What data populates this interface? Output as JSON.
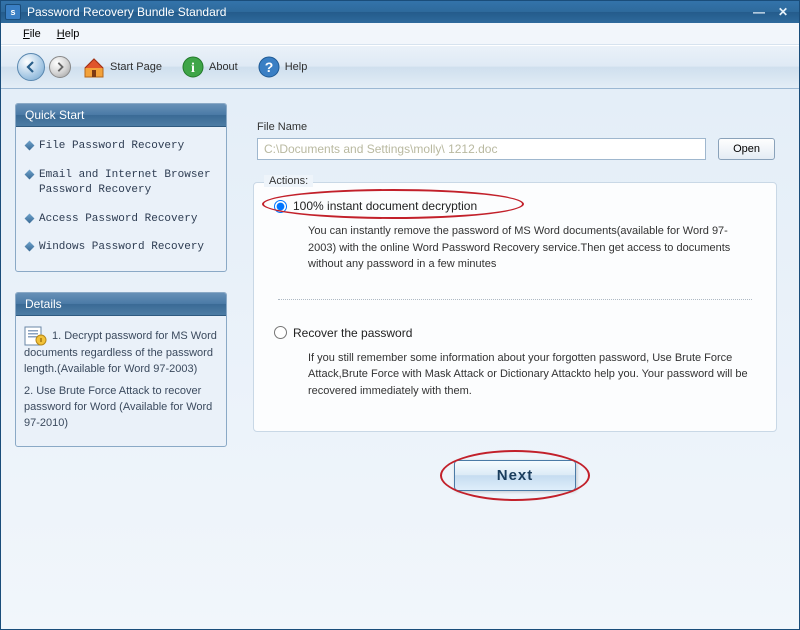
{
  "title": "Password Recovery Bundle Standard",
  "menu": {
    "file": "File",
    "help": "Help"
  },
  "toolbar": {
    "start": "Start Page",
    "about": "About",
    "help": "Help"
  },
  "sidebar": {
    "quickstart": {
      "header": "Quick Start",
      "items": [
        "File Password Recovery",
        "Email and Internet Browser Password Recovery",
        "Access Password Recovery",
        "Windows Password Recovery"
      ]
    },
    "details": {
      "header": "Details",
      "text1": "1. Decrypt password for MS Word documents regardless of the password length.(Available for Word 97-2003)",
      "text2": "2. Use Brute Force Attack to recover password for Word (Available for Word 97-2010)"
    }
  },
  "main": {
    "filename_label": "File Name",
    "filename_value": "C:\\Documents and Settings\\molly\\ 1212.doc",
    "open": "Open",
    "actions_label": "Actions:",
    "opt1_label": "100% instant document decryption",
    "opt1_desc": "You can instantly remove the password of MS Word documents(available for Word 97-2003) with the online Word Password Recovery service.Then get access to documents without any password in a few minutes",
    "opt2_label": "Recover the password",
    "opt2_desc": "If you still remember some information about your forgotten password, Use Brute Force Attack,Brute Force with Mask Attack or Dictionary Attackto help you. Your password will be recovered immediately with them.",
    "next": "Next"
  }
}
